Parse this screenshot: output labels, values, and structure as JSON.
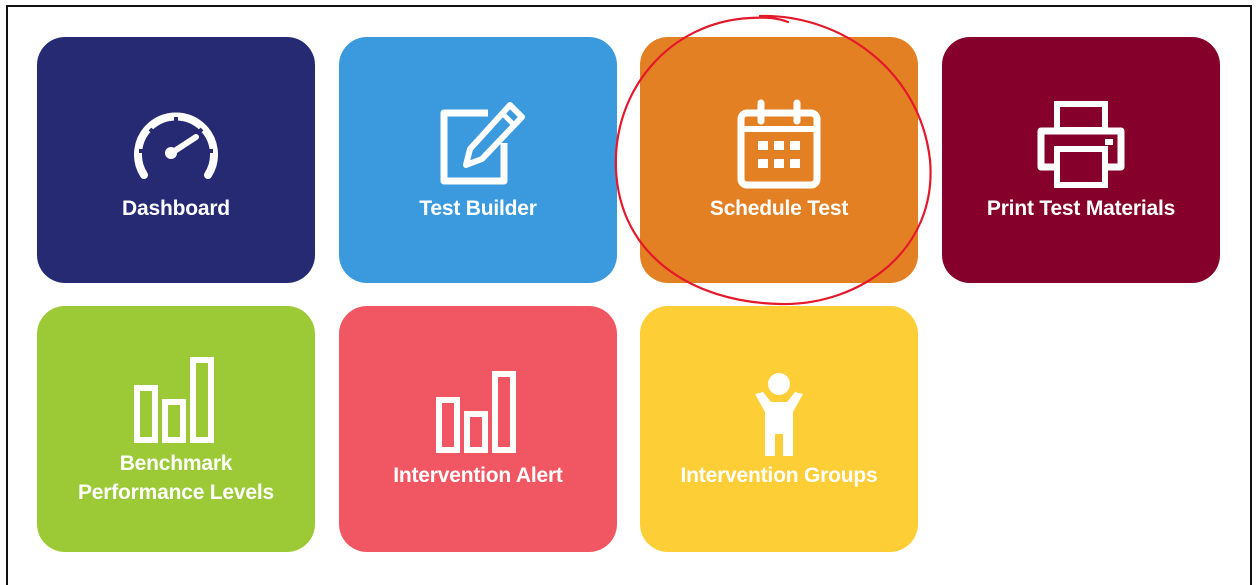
{
  "tiles": [
    {
      "key": "dashboard",
      "label": "Dashboard",
      "color": "#262a73",
      "icon": "speedometer-icon"
    },
    {
      "key": "test_builder",
      "label": "Test Builder",
      "color": "#3b9ade",
      "icon": "edit-icon"
    },
    {
      "key": "schedule_test",
      "label": "Schedule Test",
      "color": "#e48024",
      "icon": "calendar-icon"
    },
    {
      "key": "print_test_materials",
      "label": "Print Test Materials",
      "color": "#85002a",
      "icon": "printer-icon"
    },
    {
      "key": "benchmark",
      "label": "Benchmark\nPerformance Levels",
      "color": "#9bca36",
      "icon": "bar-chart-icon"
    },
    {
      "key": "intervention_alert",
      "label": "Intervention Alert",
      "color": "#f15763",
      "icon": "bar-chart-icon"
    },
    {
      "key": "intervention_groups",
      "label": "Intervention Groups",
      "color": "#fece36",
      "icon": "person-icon"
    }
  ],
  "annotation": {
    "color": "#e4182a",
    "target": "schedule_test"
  }
}
